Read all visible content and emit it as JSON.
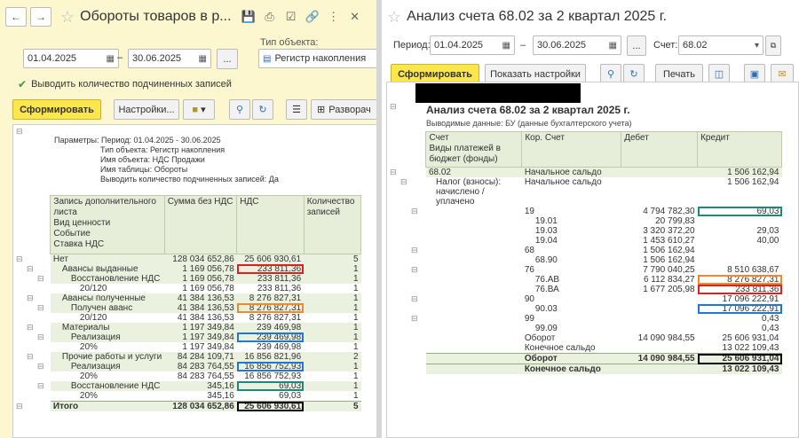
{
  "left": {
    "title": "Обороты товаров в р...",
    "date_from": "01.04.2025",
    "date_dash": "–",
    "date_to": "30.06.2025",
    "object_type_label": "Тип объекта:",
    "object_type_value": "Регистр накопления",
    "checkbox_label": "Выводить количество подчиненных записей",
    "generate_btn": "Сформировать",
    "settings_btn": "Настройки...",
    "expand_btn": "Разворач",
    "params": [
      "Параметры:  Период: 01.04.2025 - 30.06.2025",
      "Тип объекта: Регистр накопления",
      "Имя объекта: НДС Продажи",
      "Имя таблицы: Обороты",
      "Выводить количество подчиненных записей: Да"
    ],
    "headers": {
      "c1": [
        "Запись дополнительного",
        "листа",
        "Вид ценности",
        "Событие",
        "Ставка НДС"
      ],
      "c2": "Сумма без НДС",
      "c3": "НДС",
      "c4": [
        "Количество",
        "записей"
      ]
    },
    "rows": [
      {
        "name": "Нет",
        "sum": "128 034 652,86",
        "vat": "25 606 930,61",
        "cnt": "5",
        "ind": 0,
        "g": true
      },
      {
        "name": "Авансы выданные",
        "sum": "1 169 056,78",
        "vat": "233 811,36",
        "cnt": "1",
        "ind": 1,
        "g": true,
        "box": "red"
      },
      {
        "name": "Восстановление НДС",
        "sum": "1 169 056,78",
        "vat": "233 811,36",
        "cnt": "1",
        "ind": 2,
        "g": true
      },
      {
        "name": "20/120",
        "sum": "1 169 056,78",
        "vat": "233 811,36",
        "cnt": "1",
        "ind": 3
      },
      {
        "name": "Авансы полученные",
        "sum": "41 384 136,53",
        "vat": "8 276 827,31",
        "cnt": "1",
        "ind": 1,
        "g": true
      },
      {
        "name": "Получен аванс",
        "sum": "41 384 136,53",
        "vat": "8 276 827,31",
        "cnt": "1",
        "ind": 2,
        "g": true,
        "box": "ora"
      },
      {
        "name": "20/120",
        "sum": "41 384 136,53",
        "vat": "8 276 827,31",
        "cnt": "1",
        "ind": 3
      },
      {
        "name": "Материалы",
        "sum": "1 197 349,84",
        "vat": "239 469,98",
        "cnt": "1",
        "ind": 1,
        "g": true
      },
      {
        "name": "Реализация",
        "sum": "1 197 349,84",
        "vat": "239 469,98",
        "cnt": "1",
        "ind": 2,
        "g": true,
        "box": "blu"
      },
      {
        "name": "20%",
        "sum": "1 197 349,84",
        "vat": "239 469,98",
        "cnt": "1",
        "ind": 3
      },
      {
        "name": "Прочие работы и услуги",
        "sum": "84 284 109,71",
        "vat": "16 856 821,96",
        "cnt": "2",
        "ind": 1,
        "g": true
      },
      {
        "name": "Реализация",
        "sum": "84 283 764,55",
        "vat": "16 856 752,93",
        "cnt": "1",
        "ind": 2,
        "g": true,
        "box": "blu"
      },
      {
        "name": "20%",
        "sum": "84 283 764,55",
        "vat": "16 856 752,93",
        "cnt": "1",
        "ind": 3
      },
      {
        "name": "Восстановление НДС",
        "sum": "345,16",
        "vat": "69,03",
        "cnt": "1",
        "ind": 2,
        "g": true,
        "box": "teal"
      },
      {
        "name": "20%",
        "sum": "345,16",
        "vat": "69,03",
        "cnt": "1",
        "ind": 3
      },
      {
        "name": "Итого",
        "sum": "128 034 652,86",
        "vat": "25 606 930,61",
        "cnt": "5",
        "ind": 0,
        "g": true,
        "bold": true,
        "box": "blk"
      }
    ]
  },
  "right": {
    "title": "Анализ счета 68.02 за 2 квартал 2025 г.",
    "period_label": "Период:",
    "date_from": "01.04.2025",
    "date_dash": "–",
    "date_to": "30.06.2025",
    "account_label": "Счет:",
    "account_value": "68.02",
    "generate_btn": "Сформировать",
    "show_settings_btn": "Показать настройки",
    "print_btn": "Печать",
    "report_title": "Анализ счета 68.02 за 2 квартал 2025 г.",
    "report_sub": "Выводимые данные: БУ (данные бухгалтерского учета)",
    "headers": {
      "c1": [
        "Счет",
        "Виды платежей в",
        "бюджет (фонды)"
      ],
      "c2": "Кор. Счет",
      "c3": "Дебет",
      "c4": "Кредит"
    },
    "rows": [
      {
        "a": "68.02",
        "k": "Начальное сальдо",
        "d": "",
        "c": "1 506 162,94",
        "g": true
      },
      {
        "a": "Налог (взносы):",
        "k": "Начальное сальдо",
        "d": "",
        "c": "1 506 162,94",
        "ind": 1
      },
      {
        "a": "начислено /",
        "k": "",
        "d": "",
        "c": "",
        "ind": 1
      },
      {
        "a": "уплачено",
        "k": "",
        "d": "",
        "c": "",
        "ind": 1
      },
      {
        "a": "",
        "k": "19",
        "d": "4 794 782,30",
        "c": "69,03",
        "cbox": "teal"
      },
      {
        "a": "",
        "k": "19.01",
        "d": "20 799,83",
        "c": "",
        "ki": 1
      },
      {
        "a": "",
        "k": "19.03",
        "d": "3 320 372,20",
        "c": "29,03",
        "ki": 1
      },
      {
        "a": "",
        "k": "19.04",
        "d": "1 453 610,27",
        "c": "40,00",
        "ki": 1
      },
      {
        "a": "",
        "k": "68",
        "d": "1 506 162,94",
        "c": ""
      },
      {
        "a": "",
        "k": "68.90",
        "d": "1 506 162,94",
        "c": "",
        "ki": 1
      },
      {
        "a": "",
        "k": "76",
        "d": "7 790 040,25",
        "c": "8 510 638,67"
      },
      {
        "a": "",
        "k": "76.АВ",
        "d": "6 112 834,27",
        "c": "8 276 827,31",
        "ki": 1,
        "cbox": "ora"
      },
      {
        "a": "",
        "k": "76.ВА",
        "d": "1 677 205,98",
        "c": "233 811,36",
        "ki": 1,
        "cbox": "red"
      },
      {
        "a": "",
        "k": "90",
        "d": "",
        "c": "17 096 222,91"
      },
      {
        "a": "",
        "k": "90.03",
        "d": "",
        "c": "17 096 222,91",
        "ki": 1,
        "cbox": "blu"
      },
      {
        "a": "",
        "k": "99",
        "d": "",
        "c": "0,43"
      },
      {
        "a": "",
        "k": "99.09",
        "d": "",
        "c": "0,43",
        "ki": 1
      },
      {
        "a": "",
        "k": "Оборот",
        "d": "14 090 984,55",
        "c": "25 606 931,04"
      },
      {
        "a": "",
        "k": "Конечное сальдо",
        "d": "",
        "c": "13 022 109,43"
      },
      {
        "a": "",
        "k": "Оборот",
        "d": "14 090 984,55",
        "c": "25 606 931,04",
        "g": true,
        "bold": true,
        "cbox": "blk"
      },
      {
        "a": "",
        "k": "Конечное сальдо",
        "d": "",
        "c": "13 022 109,43",
        "g": true,
        "bold": true
      }
    ]
  }
}
